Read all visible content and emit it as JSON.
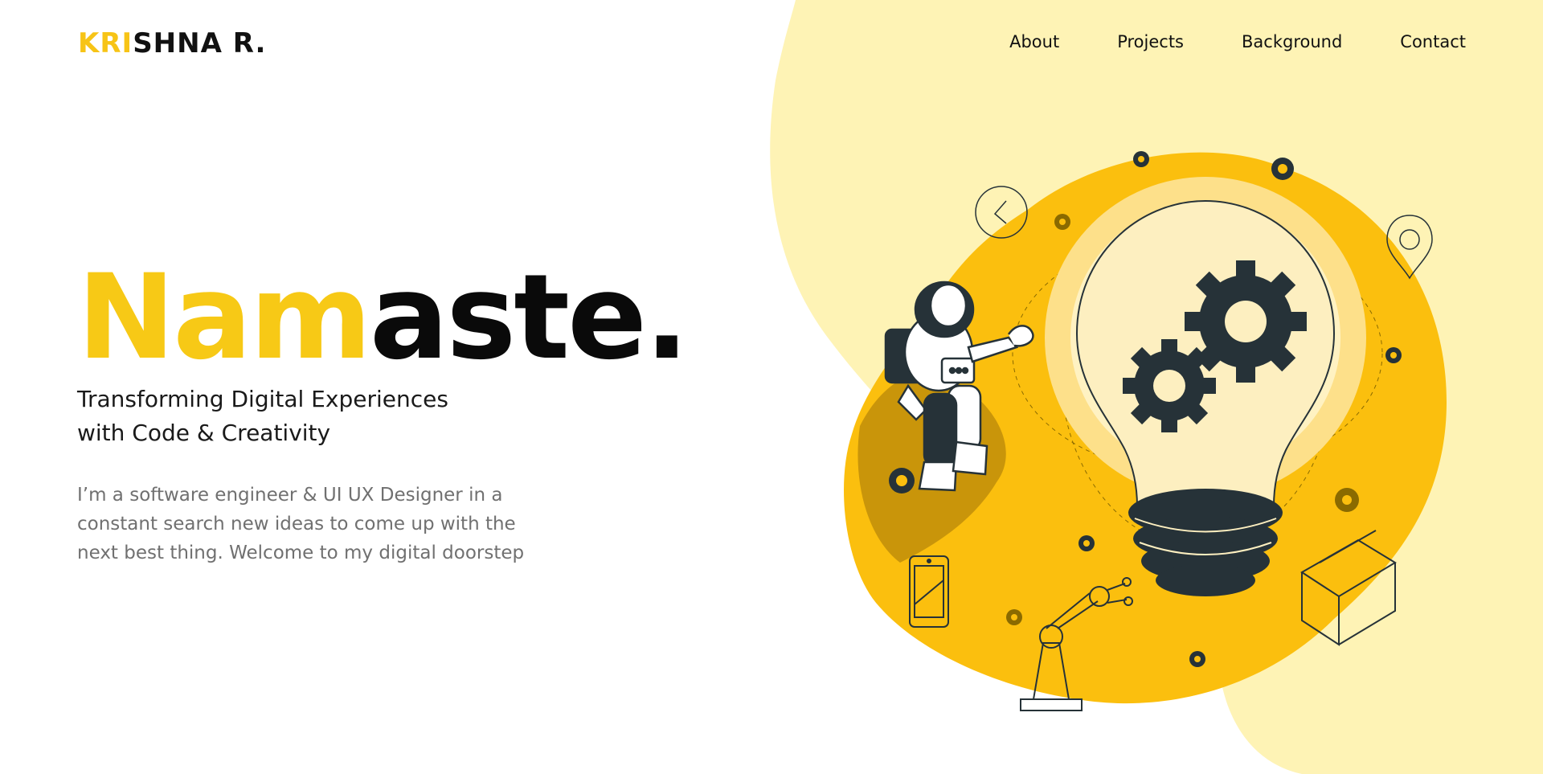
{
  "logo": {
    "accent": "KRI",
    "rest": "SHNA R."
  },
  "nav": {
    "items": [
      {
        "label": "About"
      },
      {
        "label": "Projects"
      },
      {
        "label": "Background"
      },
      {
        "label": "Contact"
      }
    ]
  },
  "hero": {
    "title_accent": "Nam",
    "title_rest": "aste.",
    "subtitle_line1": "Transforming Digital Experiences",
    "subtitle_line2": "with Code & Creativity",
    "description": "I’m a software engineer & UI UX Designer in a constant search new ideas to come up with the next best thing. Welcome to my digital doorstep"
  },
  "colors": {
    "accent": "#f7c416",
    "pale_yellow": "#fef3b5",
    "blob_yellow": "#fbbf0e",
    "dark": "#263238"
  },
  "illustration": {
    "icons": [
      "lightbulb-icon",
      "astronaut-icon",
      "gear-icon",
      "phone-icon",
      "robot-arm-icon",
      "box-icon",
      "location-pin-icon",
      "clock-icon"
    ]
  }
}
